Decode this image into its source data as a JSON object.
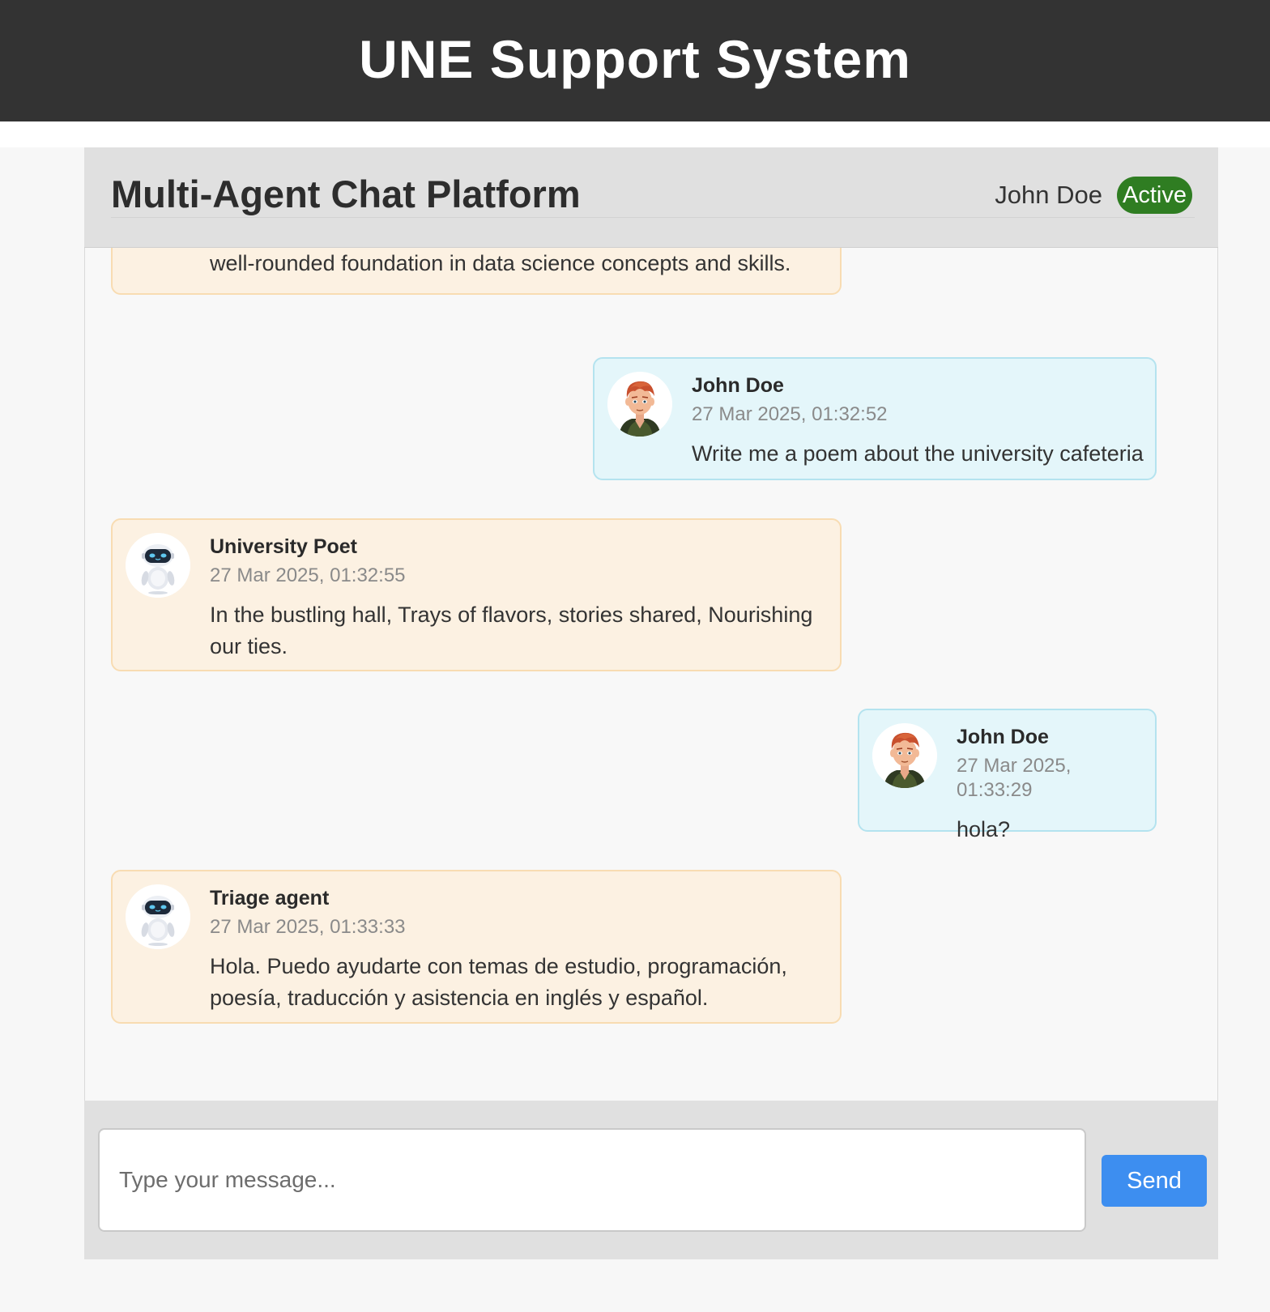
{
  "site": {
    "title": "UNE Support System"
  },
  "app": {
    "title": "Multi-Agent Chat Platform",
    "user": {
      "name": "John Doe",
      "status": "Active",
      "status_color": "#2f7d22"
    }
  },
  "messages": [
    {
      "role": "bot",
      "partial": true,
      "text": "well-rounded foundation in data science concepts and skills."
    },
    {
      "role": "user",
      "sender": "John Doe",
      "time": "27 Mar 2025, 01:32:52",
      "text": "Write me a poem about the university cafeteria",
      "avatar": "user-avatar-icon"
    },
    {
      "role": "bot",
      "sender": "University Poet",
      "time": "27 Mar 2025, 01:32:55",
      "text": "In the bustling hall, Trays of flavors, stories shared, Nourishing our ties.",
      "avatar": "robot-avatar-icon"
    },
    {
      "role": "user",
      "sender": "John Doe",
      "time": "27 Mar 2025, 01:33:29",
      "text": "hola?",
      "avatar": "user-avatar-icon"
    },
    {
      "role": "bot",
      "sender": "Triage agent",
      "time": "27 Mar 2025, 01:33:33",
      "text": "Hola. Puedo ayudarte con temas de estudio, programación, poesía, traducción y asistencia en inglés y español.",
      "avatar": "robot-avatar-icon"
    }
  ],
  "composer": {
    "placeholder": "Type your message...",
    "value": "",
    "send_label": "Send",
    "send_color": "#3d8ef0"
  },
  "colors": {
    "header_bg": "#333333",
    "bot_bubble_bg": "#fcf1e2",
    "user_bubble_bg": "#e4f6fa"
  }
}
